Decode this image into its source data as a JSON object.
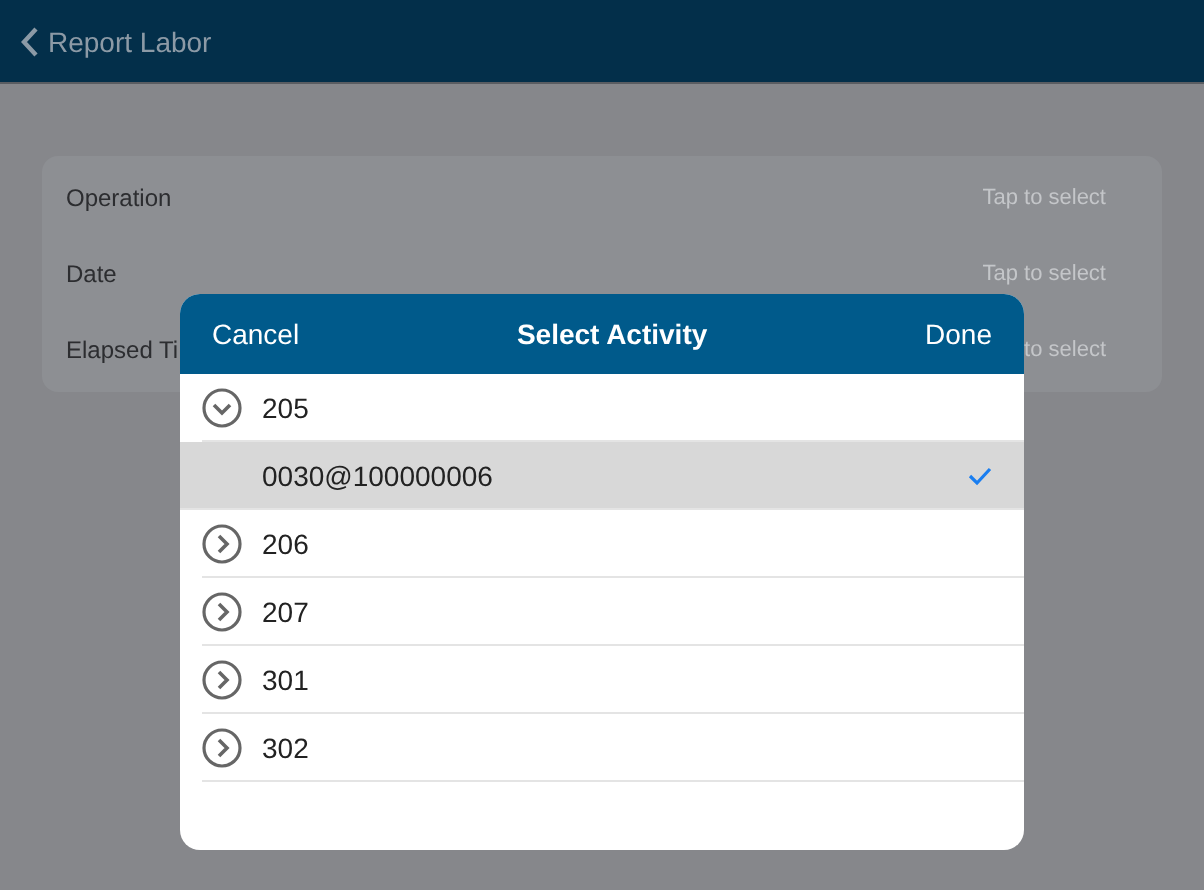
{
  "nav_bar": {
    "back_label": "Report Labor"
  },
  "form": {
    "rows": [
      {
        "label": "Operation",
        "value": "Tap to select"
      },
      {
        "label": "Date",
        "value": "Tap to select"
      },
      {
        "label": "Elapsed Ti",
        "value": "to select"
      }
    ]
  },
  "dialog": {
    "cancel": "Cancel",
    "title": "Select Activity",
    "done": "Done",
    "items": [
      {
        "label": "205",
        "expanded": true,
        "selected": false,
        "children": [
          {
            "label": "0030@100000006",
            "selected": true
          }
        ]
      },
      {
        "label": "206",
        "expanded": false,
        "selected": false
      },
      {
        "label": "207",
        "expanded": false,
        "selected": false
      },
      {
        "label": "301",
        "expanded": false,
        "selected": false
      },
      {
        "label": "302",
        "expanded": false,
        "selected": false
      }
    ]
  }
}
